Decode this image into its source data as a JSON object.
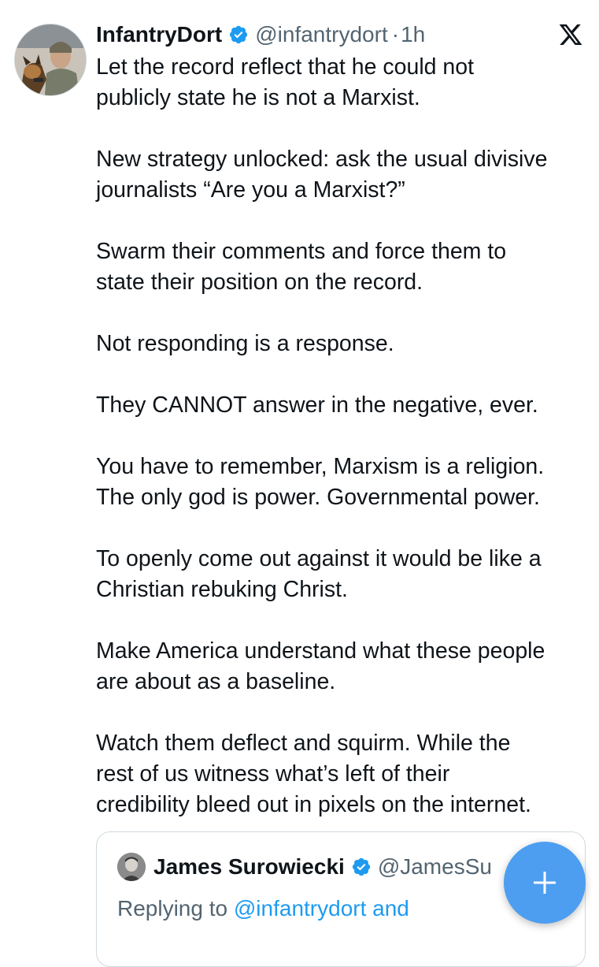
{
  "tweet": {
    "author_name": "InfantryDort",
    "handle": "@infantrydort",
    "separator": "·",
    "time": "1h",
    "paragraphs": [
      "Let the record reflect that he could not\npublicly state he is not a Marxist.",
      "New strategy unlocked: ask the usual divisive\njournalists “Are you a Marxist?”",
      "Swarm their comments and force them to\nstate their position on the record.",
      "Not responding is a response.",
      "They CANNOT answer in the negative, ever.",
      "You have to remember, Marxism is a religion.\nThe only god is power. Governmental power.",
      "To openly come out against it would be like a\nChristian rebuking Christ.",
      "Make America understand what these people\nare about as a baseline.",
      "Watch them deflect and squirm.  While the\nrest of us witness what’s left of their\ncredibility bleed out in pixels on the internet."
    ]
  },
  "quote": {
    "author_name": "James Surowiecki",
    "handle": "@JamesSu",
    "replying_prefix": "Replying to ",
    "replying_mention": "@infantrydort and"
  },
  "icons": {
    "logo": "x-logo-icon",
    "verified": "verified-badge-icon",
    "compose": "plus-icon"
  },
  "colors": {
    "accent": "#1d9bf0",
    "fab": "#4d9ef0",
    "text": "#0f1419",
    "muted": "#536471",
    "border": "#cfd9de"
  }
}
